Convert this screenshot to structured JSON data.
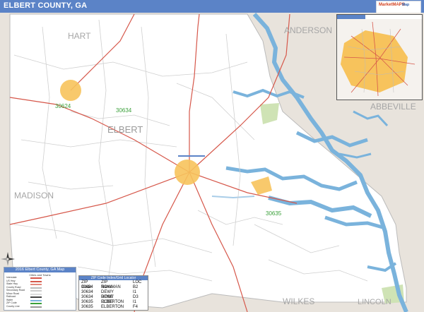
{
  "header": {
    "title": "ELBERT COUNTY, GA",
    "brand_primary": "MarketMAPS",
    "brand_secondary": "Map",
    "bar_color": "#5b83c7"
  },
  "map": {
    "county_labels": [
      "HART",
      "ANDERSON",
      "ABBEVILLE",
      "MADISON",
      "WILKES",
      "LINCOLN",
      "ELBERT"
    ],
    "zip_labels": [
      "30624",
      "30634",
      "30635"
    ],
    "colors": {
      "land_outside": "#e8e3dc",
      "county_fill": "#ffffff",
      "water": "#7ab3dc",
      "zip_highlight": "#f7c35c",
      "road_major": "#d6574a",
      "road_minor": "#c8c8c8",
      "state_park": "#cfe3b5"
    }
  },
  "compass": {
    "icon": "north-arrow-icon",
    "label": "N"
  },
  "inset": {
    "icon": "inset-locator-icon"
  },
  "legend": {
    "title": "2016 Elbert County, GA Map",
    "subtitle": "Cities and Towns",
    "rows": [
      {
        "name": "Interstate",
        "type": "Primary",
        "name2": "",
        "color": "#d6574a"
      },
      {
        "name": "US Hwy",
        "type": "",
        "name2": "",
        "color": "#d6574a"
      },
      {
        "name": "State Hwy",
        "type": "",
        "name2": "",
        "color": "#e38a7e"
      },
      {
        "name": "County Road",
        "type": "",
        "name2": "",
        "color": "#bbbbbb"
      },
      {
        "name": "Secondary Road",
        "type": "",
        "name2": "",
        "color": "#cccccc"
      },
      {
        "name": "Minor Road",
        "type": "",
        "name2": "",
        "color": "#dddddd"
      },
      {
        "name": "Railroad",
        "type": "",
        "name2": "",
        "color": "#444444"
      },
      {
        "name": "Water",
        "type": "",
        "name2": "",
        "color": "#7ab3dc"
      },
      {
        "name": "ZIP Code",
        "type": "",
        "name2": "",
        "color": "#3aa03a"
      },
      {
        "name": "County Line",
        "type": "",
        "name2": "",
        "color": "#999999"
      }
    ]
  },
  "zip_index": {
    "title": "ZIP Code Index/Grid Locator",
    "headers": [
      "ZIP Code",
      "ZIP Name",
      "LOC"
    ],
    "rows": [
      [
        "30624",
        "BOWMAN",
        "B2"
      ],
      [
        "30634",
        "DEWY ROSE",
        "I1"
      ],
      [
        "30634",
        "DEWY ROSE",
        "D3"
      ],
      [
        "30635",
        "ELBERTON",
        "I1"
      ],
      [
        "30635",
        "ELBERTON",
        "F4"
      ]
    ]
  }
}
